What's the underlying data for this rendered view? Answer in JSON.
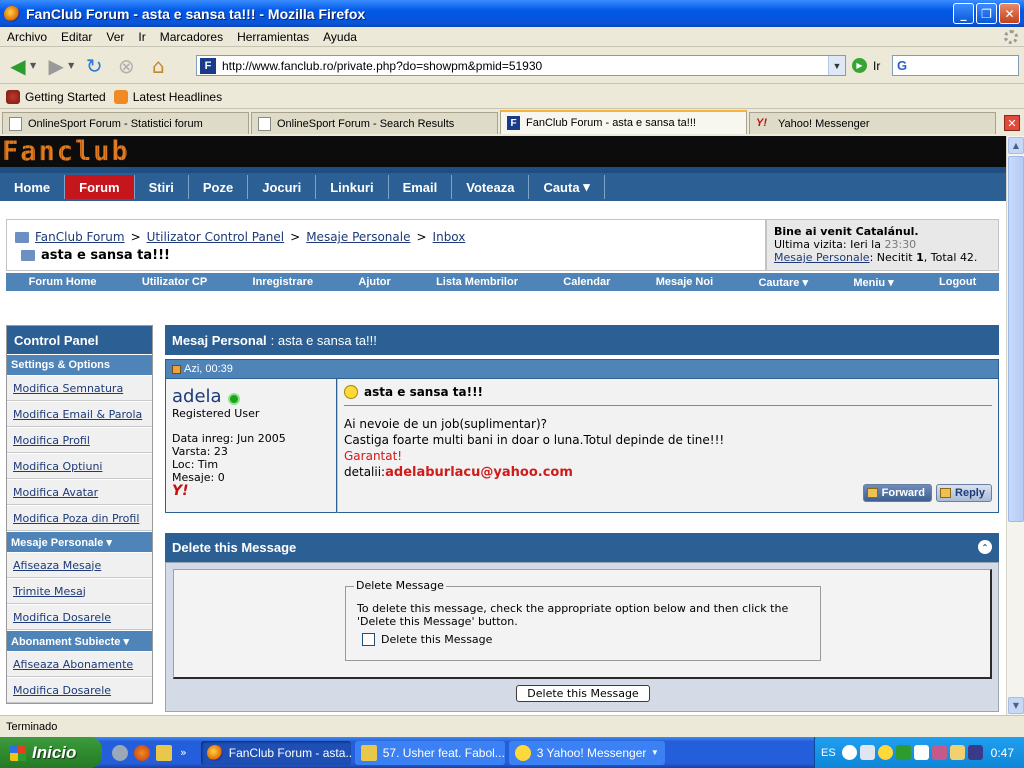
{
  "window": {
    "title": "FanClub Forum - asta e sansa ta!!! - Mozilla Firefox"
  },
  "menu": [
    "Archivo",
    "Editar",
    "Ver",
    "Ir",
    "Marcadores",
    "Herramientas",
    "Ayuda"
  ],
  "nav": {
    "url": "http://www.fanclub.ro/private.php?do=showpm&pmid=51930",
    "go_label": "Ir",
    "search_value": "G"
  },
  "bookmarks": [
    "Getting Started",
    "Latest Headlines"
  ],
  "tabs": [
    "OnlineSport Forum - Statistici forum",
    "OnlineSport Forum - Search Results",
    "FanClub Forum - asta e sansa ta!!!",
    "Yahoo! Messenger"
  ],
  "site": {
    "logo": "Fanclub",
    "nav": [
      "Home",
      "Forum",
      "Stiri",
      "Poze",
      "Jocuri",
      "Linkuri",
      "Email",
      "Voteaza",
      "Cauta"
    ],
    "active_nav": "Forum"
  },
  "breadcrumb": {
    "items": [
      "FanClub Forum",
      "Utilizator Control Panel",
      "Mesaje Personale",
      "Inbox"
    ],
    "separator": ">",
    "current": "asta e sansa ta!!!"
  },
  "welcome": {
    "greeting": "Bine ai venit Catalánul.",
    "last_visit_label": "Ultima vizita:",
    "last_visit_day": "Ieri la",
    "last_visit_time": "23:30",
    "pm_link": "Mesaje Personale",
    "pm_unread_label": ": Necitit",
    "pm_unread": "1",
    "pm_total_label": ", Total",
    "pm_total": "42."
  },
  "subnav": [
    "Forum Home",
    "Utilizator CP",
    "Inregistrare",
    "Ajutor",
    "Lista Membrilor",
    "Calendar",
    "Mesaje Noi",
    "Cautare ▾",
    "Meniu ▾",
    "Logout"
  ],
  "sidebar": {
    "title": "Control Panel",
    "sections": [
      {
        "heading": "Settings & Options",
        "items": [
          "Modifica Semnatura",
          "Modifica Email & Parola",
          "Modifica Profil",
          "Modifica Optiuni",
          "Modifica Avatar",
          "Modifica Poza din Profil"
        ]
      },
      {
        "heading": "Mesaje Personale ▾",
        "items": [
          "Afiseaza Mesaje",
          "Trimite Mesaj",
          "Modifica Dosarele"
        ]
      },
      {
        "heading": "Abonament Subiecte ▾",
        "items": [
          "Afiseaza Abonamente",
          "Modifica Dosarele"
        ]
      }
    ]
  },
  "message": {
    "header_label": "Mesaj Personal",
    "header_subject": ": asta e sansa ta!!!",
    "date": "Azi, 00:39",
    "user": {
      "name": "adela",
      "rank": "Registered User",
      "join": "Data inreg: Jun 2005",
      "age": "Varsta: 23",
      "location": "Loc: Tim",
      "posts": "Mesaje: 0",
      "yahoo": "Y!"
    },
    "subject": "asta e sansa ta!!!",
    "line1": "Ai nevoie de un job(suplimentar)?",
    "line2": "Castiga foarte multi bani in doar o luna.Totul depinde de tine!!!",
    "line3": "Garantat!",
    "line4_label": "detalii:",
    "line4_email": "adelaburlacu@yahoo.com",
    "forward_label": "Forward",
    "reply_label": "Reply"
  },
  "delete_box": {
    "title": "Delete this Message",
    "legend": "Delete Message",
    "description": "To delete this message, check the appropriate option below and then click the 'Delete this Message' button.",
    "checkbox_label": "Delete this Message",
    "button_label": "Delete this Message"
  },
  "status": "Terminado",
  "taskbar": {
    "start": "Inicio",
    "more": "»",
    "buttons": [
      "FanClub Forum - asta...",
      "57. Usher feat. Fabol...",
      "3 Yahoo! Messenger"
    ],
    "lang": "ES",
    "clock": "0:47"
  }
}
